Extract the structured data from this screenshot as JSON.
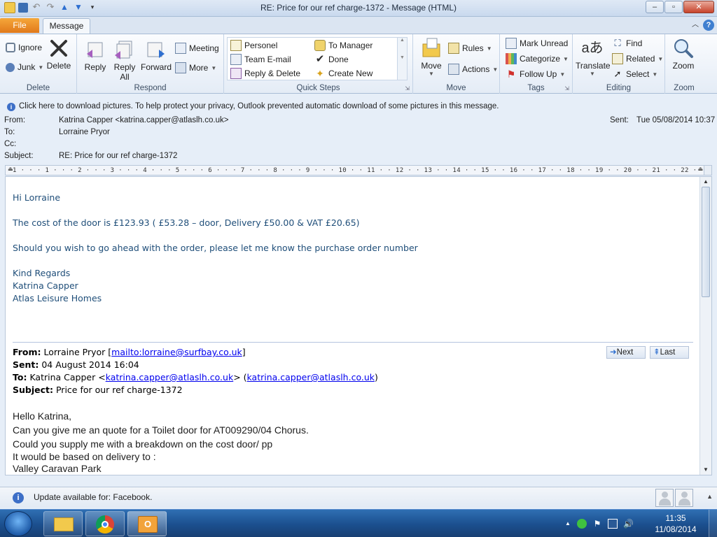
{
  "window": {
    "title": "RE: Price for our ref charge-1372  -  Message (HTML)",
    "min_label": "–",
    "max_label": "▫",
    "close_label": "✕"
  },
  "tabs": {
    "file": "File",
    "message": "Message"
  },
  "ribbon": {
    "delete_group": {
      "label": "Delete",
      "ignore": "Ignore",
      "junk": "Junk",
      "delete": "Delete"
    },
    "respond_group": {
      "label": "Respond",
      "reply": "Reply",
      "reply_all_1": "Reply",
      "reply_all_2": "All",
      "forward": "Forward",
      "meeting": "Meeting",
      "more": "More"
    },
    "quick_steps": {
      "label": "Quick Steps",
      "items": [
        "Personel",
        "To Manager",
        "Team E-mail",
        "Done",
        "Reply & Delete",
        "Create New"
      ]
    },
    "move_group": {
      "label": "Move",
      "move": "Move",
      "rules": "Rules",
      "actions": "Actions"
    },
    "tags_group": {
      "label": "Tags",
      "mark_unread": "Mark Unread",
      "categorize": "Categorize",
      "follow_up": "Follow Up"
    },
    "editing_group": {
      "label": "Editing",
      "translate": "Translate",
      "find": "Find",
      "related": "Related",
      "select": "Select"
    },
    "zoom_group": {
      "label": "Zoom",
      "zoom": "Zoom"
    }
  },
  "infobar": {
    "text": "Click here to download pictures. To help protect your privacy, Outlook prevented automatic download of some pictures in this message."
  },
  "headers": {
    "from_label": "From:",
    "from_value": "Katrina Capper <katrina.capper@atlaslh.co.uk>",
    "to_label": "To:",
    "to_value": "Lorraine Pryor",
    "cc_label": "Cc:",
    "subject_label": "Subject:",
    "subject_value": "RE: Price for our ref charge-1372",
    "sent_label": "Sent:",
    "sent_value": "Tue 05/08/2014 10:37"
  },
  "ruler": {
    "scale": "1 · · · 1 · · · 2 · · · 3 · · · 4 · · · 5 · · · 6 · · · 7 · · · 8 · · · 9 · · · 10 · · 11 · · 12 · · 13 · · 14 · · 15 · · 16 · · 17 · · 18 · · 19 · · 20 · · 21 · · 22 · · 23 · · 24 · · 25 ·"
  },
  "reply_body": {
    "greeting": "Hi Lorraine",
    "line1": "The cost of the door is £123.93 ( £53.28 – door, Delivery £50.00 & VAT £20.65)",
    "line2": "Should you wish to go ahead with the order, please let me know the purchase order number",
    "sign1": "Kind Regards",
    "sign2": "Katrina Capper",
    "sign3": "Atlas Leisure Homes"
  },
  "original": {
    "from_label": "From:",
    "from_name": "Lorraine Pryor [",
    "from_link": "mailto:lorraine@surfbay.co.uk",
    "from_close": "]",
    "sent_label": "Sent:",
    "sent_value": "04 August 2014 16:04",
    "to_label": "To:",
    "to_name": "Katrina Capper <",
    "to_link1": "katrina.capper@atlaslh.co.uk",
    "to_mid": "> (",
    "to_link2": "katrina.capper@atlaslh.co.uk",
    "to_close": ")",
    "subject_label": "Subject:",
    "subject_value": "Price for our ref charge-1372",
    "next": "Next",
    "last": "Last",
    "lines": [
      "Hello Katrina,",
      "Can you give me an quote for a Toilet door for AT009290/04 Chorus.",
      "Could you supply me with a breakdown on the cost door/ pp",
      "It would be based on delivery to :",
      "Valley Caravan Park"
    ]
  },
  "statusbar": {
    "text": "Update available for: Facebook."
  },
  "taskbar": {
    "time": "11:35",
    "date": "11/08/2014"
  }
}
